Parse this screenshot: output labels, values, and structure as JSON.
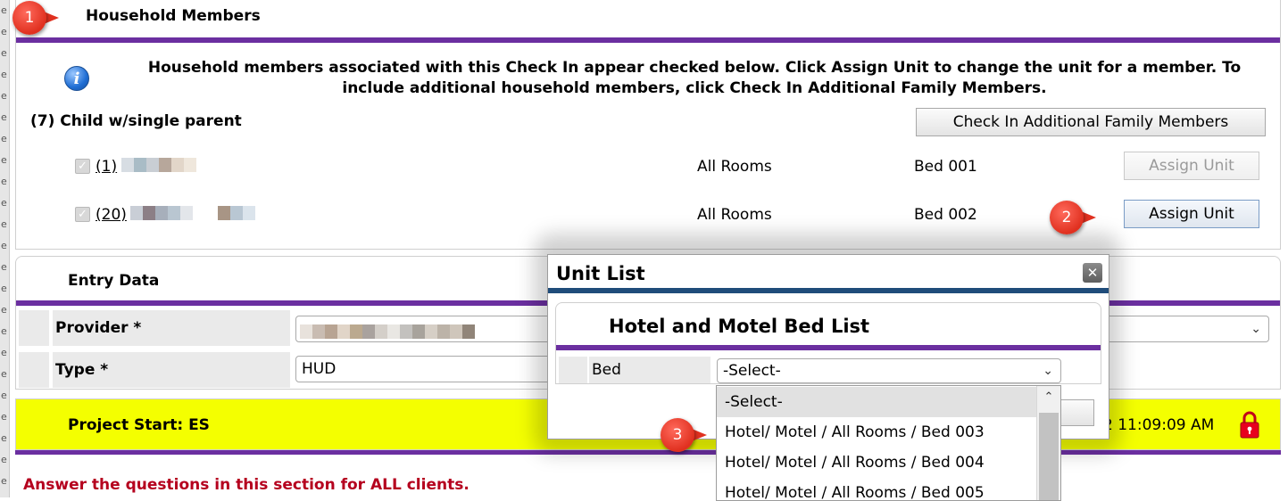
{
  "household": {
    "title": "Household Members",
    "info_text": "Household members associated with this Check In appear checked below. Click Assign Unit to change the unit for a member. To include additional household members, click Check In Additional Family Members.",
    "group_label": "(7) Child w/single parent",
    "check_in_additional_label": "Check In Additional Family Members",
    "members": [
      {
        "link": "(1)",
        "room": "All Rooms",
        "bed": "Bed 001",
        "assign_label": "Assign Unit",
        "assign_enabled": false
      },
      {
        "link": "(20)",
        "room": "All Rooms",
        "bed": "Bed 002",
        "assign_label": "Assign Unit",
        "assign_enabled": true
      }
    ]
  },
  "entry": {
    "title": "Entry Data",
    "provider_label": "Provider *",
    "type_label": "Type *",
    "type_value": "HUD"
  },
  "project": {
    "title": "Project Start: ES",
    "time_fragment": "2 11:09:09 AM",
    "note": "Answer the questions in this section for ALL clients."
  },
  "modal": {
    "title": "Unit List",
    "subtitle": "Hotel and Motel Bed List",
    "bed_label": "Bed",
    "bed_selected": "-Select-",
    "options": [
      "-Select-",
      "Hotel/ Motel / All Rooms / Bed 003",
      "Hotel/ Motel / All Rooms / Bed 004",
      "Hotel/ Motel / All Rooms / Bed 005"
    ]
  },
  "callouts": [
    "1",
    "2",
    "3"
  ],
  "gutter_letters": [
    "e",
    "e",
    "e",
    "e",
    "e",
    "e",
    "e",
    "e",
    "e",
    "e",
    "e",
    "e",
    "e",
    "e",
    "e",
    "e",
    "e",
    "e",
    "e",
    "e",
    "e",
    "e",
    "e"
  ],
  "colors": {
    "purple_bar": "#6b2fa0",
    "modal_bar": "#1f4c7a",
    "project_bg": "#f4ff00",
    "note_red": "#b5001e",
    "callout_red": "#e0301f"
  },
  "icons": {
    "info": "info-icon",
    "lock": "lock-icon",
    "close": "close-icon",
    "chevron": "chevron-down-icon"
  }
}
